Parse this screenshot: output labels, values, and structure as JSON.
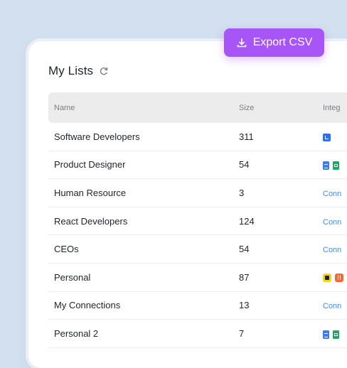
{
  "header": {
    "title": "My Lists",
    "export_label": "Export CSV"
  },
  "table": {
    "columns": {
      "name": "Name",
      "size": "Size",
      "integrations": "Integ"
    },
    "rows": [
      {
        "name": "Software Developers",
        "size": "311",
        "integration": "icons",
        "icons": [
          "linkedin-icon"
        ]
      },
      {
        "name": "Product Designer",
        "size": "54",
        "integration": "icons",
        "icons": [
          "google-docs-icon",
          "google-sheets-icon"
        ]
      },
      {
        "name": "Human Resource",
        "size": "3",
        "integration": "Conn"
      },
      {
        "name": "React Developers",
        "size": "124",
        "integration": "Conn"
      },
      {
        "name": "CEOs",
        "size": "54",
        "integration": "Conn"
      },
      {
        "name": "Personal",
        "size": "87",
        "integration": "icons",
        "icons": [
          "mailchimp-icon",
          "ycombinator-icon"
        ]
      },
      {
        "name": "My Connections",
        "size": "13",
        "integration": "Conn"
      },
      {
        "name": "Personal 2",
        "size": "7",
        "integration": "icons",
        "icons": [
          "google-docs-icon",
          "google-sheets-icon"
        ]
      }
    ]
  },
  "colors": {
    "background": "#d3e0ef",
    "accent": "#a855f7",
    "link": "#3d8ce8"
  }
}
